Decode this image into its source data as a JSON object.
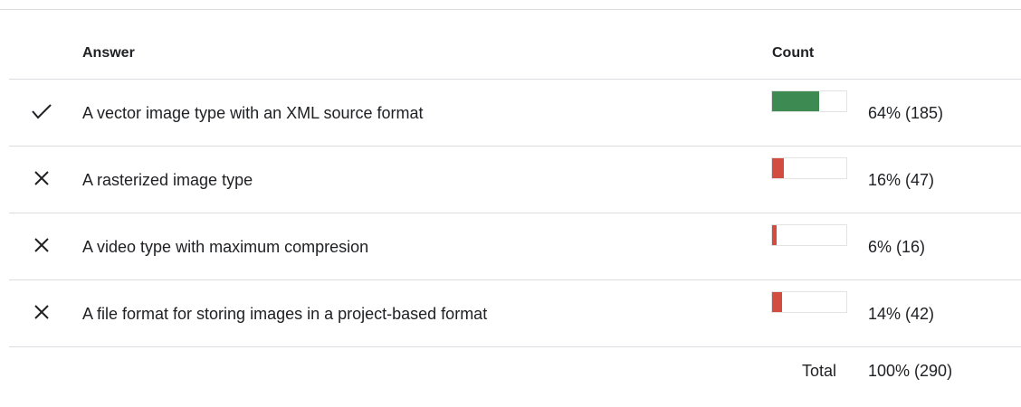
{
  "table": {
    "answer_header": "Answer",
    "count_header": "Count",
    "rows": [
      {
        "icon": "checkmark-icon",
        "answer": "A vector image type with an XML source format",
        "count": "64% (185)",
        "fraction": 0.64,
        "color": "#3d8b52"
      },
      {
        "icon": "x-mark-icon",
        "answer": "A rasterized image type",
        "count": "16% (47)",
        "fraction": 0.16,
        "color": "#d24c3f"
      },
      {
        "icon": "x-mark-icon",
        "answer": "A video type with maximum compresion",
        "count": "6% (16)",
        "fraction": 0.06,
        "color": "#d24c3f"
      },
      {
        "icon": "x-mark-icon",
        "answer": "A file format for storing images in a project-based format",
        "count": "14% (42)",
        "fraction": 0.14,
        "color": "#d24c3f"
      }
    ],
    "total_label": "Total",
    "total_value": "100% (290)"
  }
}
